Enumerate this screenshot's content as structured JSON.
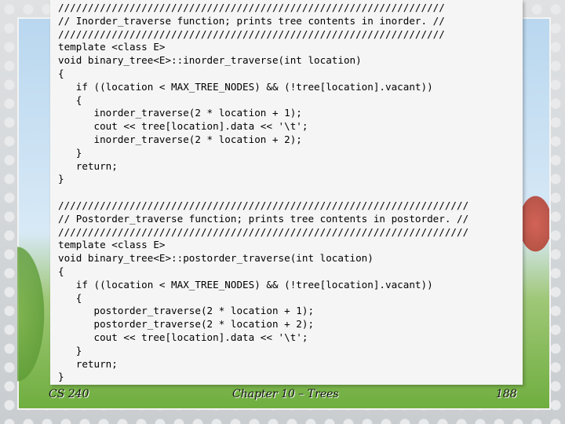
{
  "code_lines": [
    "/////////////////////////////////////////////////////////////////",
    "// Inorder_traverse function; prints tree contents in inorder. //",
    "/////////////////////////////////////////////////////////////////",
    "template <class E>",
    "void binary_tree<E>::inorder_traverse(int location)",
    "{",
    "   if ((location < MAX_TREE_NODES) && (!tree[location].vacant))",
    "   {",
    "      inorder_traverse(2 * location + 1);",
    "      cout << tree[location].data << '\\t';",
    "      inorder_traverse(2 * location + 2);",
    "   }",
    "   return;",
    "}",
    "",
    "/////////////////////////////////////////////////////////////////////",
    "// Postorder_traverse function; prints tree contents in postorder. //",
    "/////////////////////////////////////////////////////////////////////",
    "template <class E>",
    "void binary_tree<E>::postorder_traverse(int location)",
    "{",
    "   if ((location < MAX_TREE_NODES) && (!tree[location].vacant))",
    "   {",
    "      postorder_traverse(2 * location + 1);",
    "      postorder_traverse(2 * location + 2);",
    "      cout << tree[location].data << '\\t';",
    "   }",
    "   return;",
    "}"
  ],
  "footer": {
    "course": "CS 240",
    "chapter": "Chapter 10 – Trees",
    "page": "188"
  }
}
